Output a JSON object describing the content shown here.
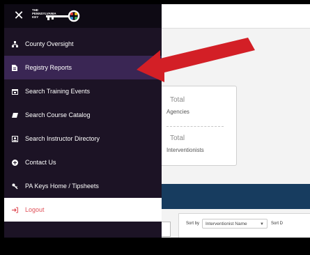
{
  "header": {
    "close_symbol": "✕",
    "logo_lines": [
      "THE",
      "PENNSYLVANIA",
      "KEY"
    ]
  },
  "nav": {
    "items": [
      {
        "label": "County Oversight",
        "icon": "org-chart-icon"
      },
      {
        "label": "Registry Reports",
        "icon": "report-icon"
      },
      {
        "label": "Search Training Events",
        "icon": "calendar-icon"
      },
      {
        "label": "Search Course Catalog",
        "icon": "book-icon"
      },
      {
        "label": "Search Instructor Directory",
        "icon": "id-card-icon"
      },
      {
        "label": "Contact Us",
        "icon": "contact-icon"
      },
      {
        "label": "PA Keys Home / Tipsheets",
        "icon": "key-icon"
      },
      {
        "label": "Logout",
        "icon": "logout-icon"
      }
    ],
    "active_index": 1
  },
  "stats": {
    "total_agencies_num": "Total",
    "total_agencies_label": "Agencies",
    "total_interventionists_num": "Total",
    "total_interventionists_label": "Interventionists"
  },
  "filters": {
    "sort_by_label": "Sort by",
    "sort_value": "Interventionist Name",
    "sort_by_label_2": "Sort D"
  },
  "colors": {
    "drawer": "#1c1325",
    "active": "#3a2654",
    "logout_text": "#e0525a",
    "arrow": "#d31f26",
    "band": "#173c5f"
  }
}
